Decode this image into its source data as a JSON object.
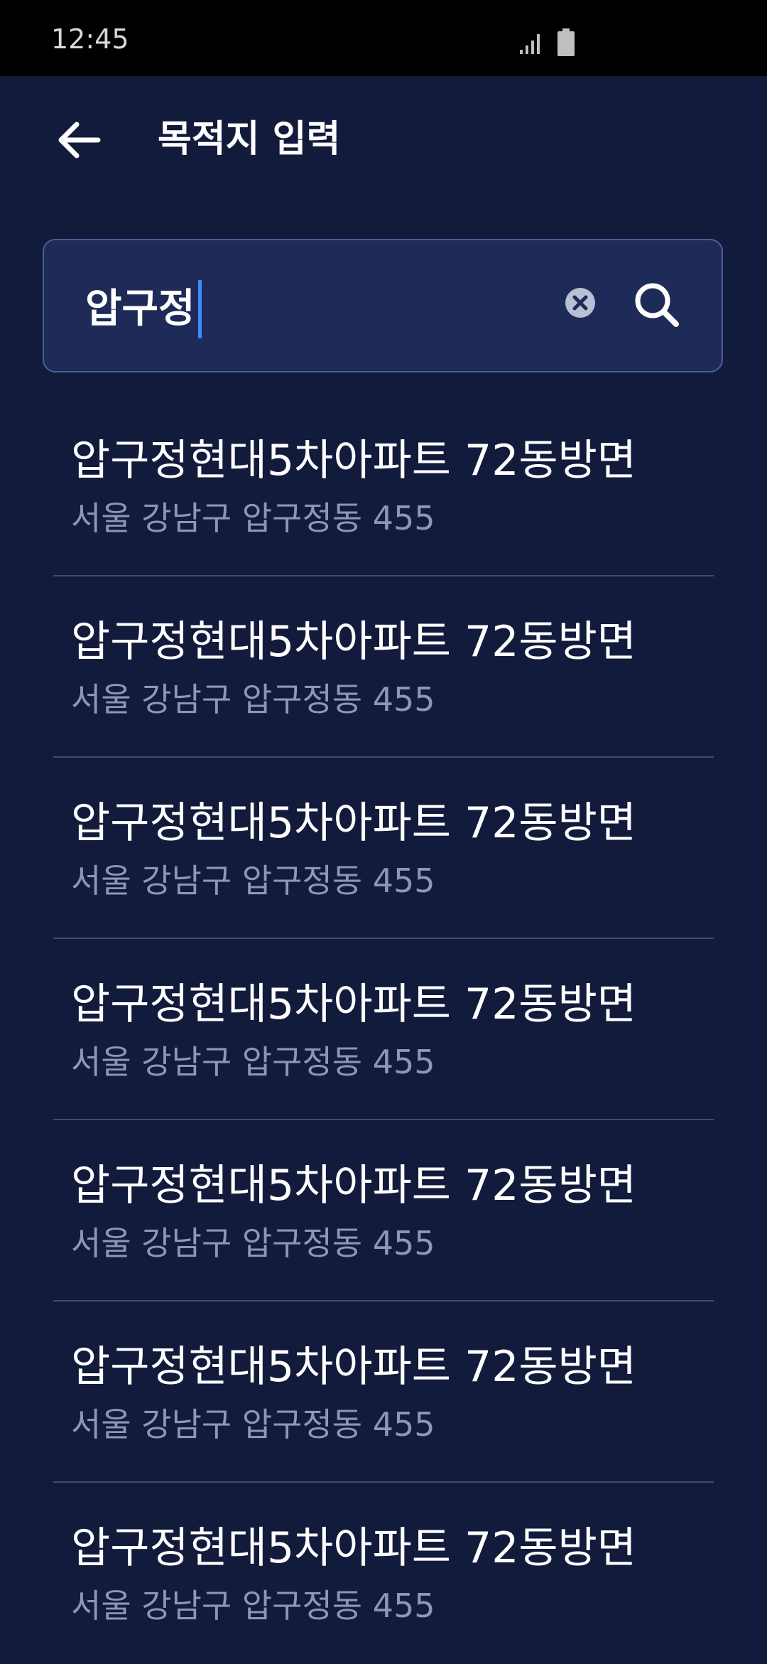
{
  "status_bar": {
    "time": "12:45",
    "signal_icon": "cell-signal-icon",
    "battery_icon": "battery-icon"
  },
  "header": {
    "back_icon": "arrow-left-icon",
    "title": "목적지 입력"
  },
  "search": {
    "value": "압구정",
    "clear_icon": "clear-circle-icon",
    "search_icon": "search-icon"
  },
  "results": [
    {
      "name": "압구정현대5차아파트 72동방면",
      "address": "서울 강남구 압구정동 455"
    },
    {
      "name": "압구정현대5차아파트 72동방면",
      "address": "서울 강남구 압구정동 455"
    },
    {
      "name": "압구정현대5차아파트 72동방면",
      "address": "서울 강남구 압구정동 455"
    },
    {
      "name": "압구정현대5차아파트 72동방면",
      "address": "서울 강남구 압구정동 455"
    },
    {
      "name": "압구정현대5차아파트 72동방면",
      "address": "서울 강남구 압구정동 455"
    },
    {
      "name": "압구정현대5차아파트 72동방면",
      "address": "서울 강남구 압구정동 455"
    },
    {
      "name": "압구정현대5차아파트 72동방면",
      "address": "서울 강남구 압구정동 455"
    }
  ],
  "colors": {
    "background": "#121b3c",
    "status_bar": "#000000",
    "search_box": "#1e2b58",
    "search_border": "#4c5e95",
    "caret": "#3d8bff",
    "secondary_text": "#8b96b8",
    "divider": "#3a4a7a"
  }
}
